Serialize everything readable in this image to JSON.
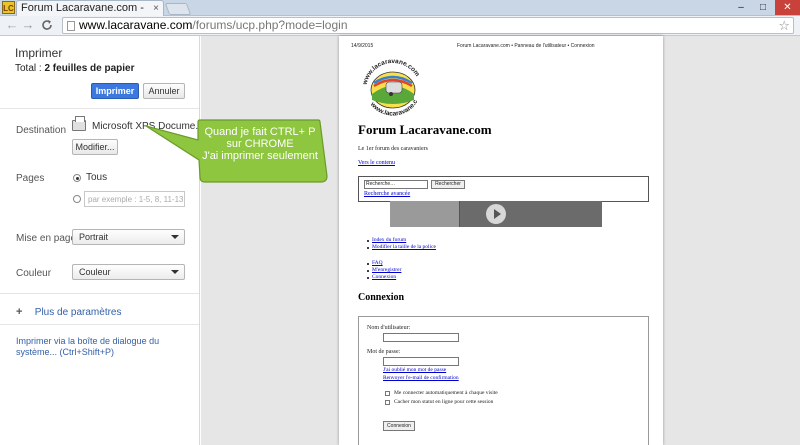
{
  "browser": {
    "favicon_text": "LC",
    "tab_title": "Forum Lacaravane.com -",
    "tab_close": "×",
    "url_host": "www.lacaravane.com",
    "url_path": "/forums/ucp.php?mode=login",
    "window_controls": {
      "minimize": "–",
      "maximize": "□",
      "close": "✕"
    },
    "nav": {
      "back": "←",
      "forward": "→",
      "reload": "C"
    },
    "star": "☆"
  },
  "print_dialog": {
    "title": "Imprimer",
    "total_prefix": "Total : ",
    "total_value": "2 feuilles de papier",
    "print_button": "Imprimer",
    "cancel_button": "Annuler",
    "destination_label": "Destination",
    "printer_name": "Microsoft XPS Docume...",
    "modify_button": "Modifier...",
    "pages_label": "Pages",
    "pages_all_label": "Tous",
    "pages_placeholder": "par exemple : 1-5, 8, 11-13",
    "layout_label": "Mise en page",
    "layout_value": "Portrait",
    "color_label": "Couleur",
    "color_value": "Couleur",
    "more_settings": "Plus de paramètres",
    "system_dialog": "Imprimer via la boîte de dialogue du système... (Ctrl+Shift+P)"
  },
  "preview": {
    "header_date": "14/9/2015",
    "header_title": "Forum Lacaravane.com • Panneau de l'utilisateur • Connexion",
    "logo_text_top": "www.lacaravane.com",
    "logo_text_bottom": "www.lacaravane.com",
    "site_title": "Forum Lacaravane.com",
    "site_desc": "Le 1er forum des caravaniers",
    "skip_link": "Vers le contenu",
    "search_value": "Recherche…",
    "search_button": "Rechercher",
    "advanced_search": "Recherche avancée",
    "nav_links_1": [
      "Index du forum",
      "Modifier la taille de la police"
    ],
    "nav_links_2": [
      "FAQ",
      "M'enregistrer",
      "Connexion"
    ],
    "section_title": "Connexion",
    "username_label": "Nom d'utilisateur:",
    "password_label": "Mot de passe:",
    "forgot_password": "J'ai oublié mon mot de passe",
    "resend_email": "Renvoyer l'e-mail de confirmation",
    "auto_login": "Me connecter automatiquement à chaque visite",
    "hide_status": "Cacher mon statut en ligne pour cette session",
    "login_button": "Connexion"
  },
  "callout": {
    "line1": "Quand je fait CTRL+ P",
    "line2": "sur CHROME",
    "line3": "J'ai imprimer seulement",
    "fill": "#8ec63f",
    "stroke": "#6a9a2a"
  },
  "colors": {
    "print_button": "#3b78e0",
    "link": "#3360a8"
  }
}
